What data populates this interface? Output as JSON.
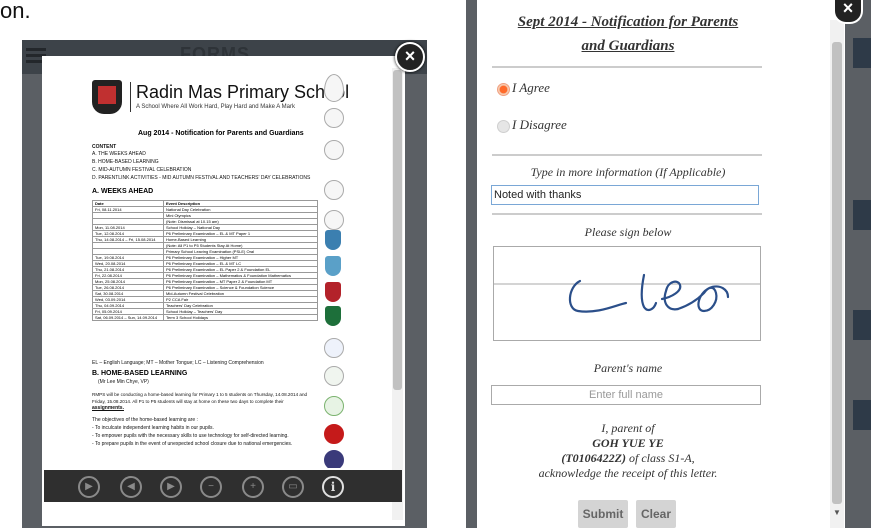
{
  "background_fragment": "on.",
  "left_panel": {
    "header_title": "FORMS",
    "close_glyph": "×",
    "document": {
      "school_name": "Radin Mas Primary School",
      "school_tagline": "A School Where All Work Hard, Play Hard and Make A Mark",
      "notice_title": "Aug 2014 - Notification for Parents and Guardians",
      "content_heading": "CONTENT",
      "content_items": [
        "A.  THE WEEKS AHEAD",
        "B.  HOME-BASED LEARNING",
        "C.  MID-AUTUMN FESTIVAL CELEBRATION",
        "D.  PARENTLINK ACTIVITIES - MID AUTUMN FESTIVAL AND TEACHERS' DAY CELEBRATIONS"
      ],
      "weeks_heading": "A. WEEKS AHEAD",
      "table_headers": [
        "Date",
        "Event Description"
      ],
      "table_rows": [
        [
          "Fri, 08.11.2014",
          "National Day Celebration"
        ],
        [
          "",
          "Mini Olympics"
        ],
        [
          "",
          "(Note: Dismissal at 10.15 am)"
        ],
        [
          "Mon, 11.08.2014",
          "School Holiday – National Day"
        ],
        [
          "Tue, 12.08.2014",
          "P6 Preliminary Examination – EL & MT Paper 1"
        ],
        [
          "Thu, 14.08.2014 – Fri, 15.08.2014",
          "Home-Based Learning"
        ],
        [
          "",
          "(Note: All P1 to P5 Students Stay At Home)"
        ],
        [
          "",
          "Primary School Leaving Examination (PSLE) Oral"
        ],
        [
          "Tue, 19.08.2014",
          "P6 Preliminary Examination – Higher MT"
        ],
        [
          "Wed, 20.08.2014",
          "P6 Preliminary Examination – EL & MT LC"
        ],
        [
          "Thu, 21.08.2014",
          "P6 Preliminary Examination – EL Paper 2 & Foundation EL"
        ],
        [
          "Fri, 22.08.2014",
          "P6 Preliminary Examination – Mathematics & Foundation Mathematics"
        ],
        [
          "Mon, 25.08.2014",
          "P6 Preliminary Examination – MT Paper 2 & Foundation MT"
        ],
        [
          "Tue, 26.08.2014",
          "P6 Preliminary Examination – Science & Foundation Science"
        ],
        [
          "Sat, 30.08.2014",
          "Mid-Autumn Festival Celebration"
        ],
        [
          "Wed, 03.09.2014",
          "P2 CCA Fair"
        ],
        [
          "Thu, 04.09.2014",
          "Teachers' Day Celebration"
        ],
        [
          "Fri, 05.09.2014",
          "School Holiday – Teachers' Day"
        ],
        [
          "Sat, 06.09.2014 – Sun, 14.09.2014",
          "Term 3 School Holidays"
        ]
      ],
      "legend_note": "EL – English Language; MT – Mother Tongue; LC – Listening Comprehension",
      "hbl_heading": "B. HOME-BASED LEARNING",
      "hbl_contact": "(Mr Lee Min Chye, VP)",
      "hbl_para_1": "RMPS will be conducting a home-based learning for Primary 1 to 5 students on Thursday, 14.08.2014 and",
      "hbl_para_2": "Friday, 15.08.2014. All P1 to P5 students will stay at home on these two days to complete their",
      "hbl_para_3": "assignments.",
      "objectives_intro": "The objectives of the home-based learning are :",
      "objectives": [
        "- To inculcate independent learning habits in our pupils.",
        "- To empower pupils with the necessary skills to use technology for self-directed learning.",
        "- To prepare pupils in the event of unexpected school closure due to national emergencies."
      ]
    },
    "toolbar": {
      "play": "▶",
      "prev": "◀",
      "next": "▶",
      "zoom_out": "−",
      "zoom_in": "+",
      "fit": "▭",
      "info": "i"
    }
  },
  "right_panel": {
    "title_line1": "Sept 2014 - Notification for Parents",
    "title_line2": "and Guardians",
    "option_agree": "I Agree",
    "option_disagree": "I Disagree",
    "selected_option": "I Agree",
    "more_info_label": "Type in more information (If Applicable)",
    "more_info_value": "Noted with thanks",
    "sign_label": "Please sign below",
    "parent_name_label": "Parent's name",
    "parent_name_placeholder": "Enter full name",
    "ack_line1": "I, parent of",
    "ack_student": "GOH YUE YE",
    "ack_id": "(T0106422Z)",
    "ack_class_pre": " of class ",
    "ack_class": "S1-A",
    "ack_class_post": ",",
    "ack_line4": "acknowledge the receipt of this letter.",
    "submit_label": "Submit",
    "clear_label": "Clear",
    "close_glyph": "×",
    "accent_color": "#ff6a2a"
  }
}
